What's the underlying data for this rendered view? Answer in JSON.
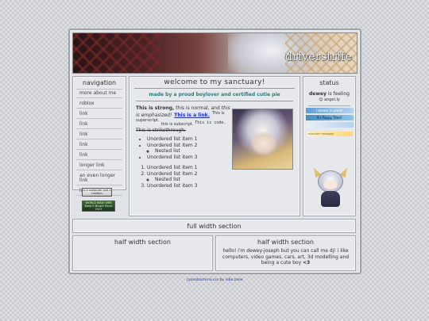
{
  "banner": {
    "logo_text": "driverstrife"
  },
  "navigation": {
    "title": "navigation",
    "items": [
      "more about me",
      "roblox",
      "link",
      "link",
      "link",
      "link",
      "link",
      "longer link",
      "an even longer link",
      "last link"
    ]
  },
  "badges": {
    "badge1": "is a computer and a modem",
    "badge2": "WORLD WIDE WEB Keep it Brown Since 2023"
  },
  "main": {
    "title": "welcome to my sanctuary!",
    "subtitle": "made by a proud boylover and certified cutie pie",
    "para": {
      "strong": "This is strong,",
      "normal": " this is normal, and",
      "emph": " this is emphasized!",
      "link": "This is a link.",
      "sup": "This is superscript.",
      "sub": "this is subscript.",
      "code": "This is code.",
      "strike": "This is strikethrough."
    },
    "ul": [
      "Unordered list item 1",
      "Unordered list item 2",
      "Nested list",
      "Unordered list item 3"
    ],
    "ol": [
      "Unordered list item 1",
      "Unordered list item 2",
      "Nested list",
      "Unordered list item 3"
    ]
  },
  "status": {
    "title": "status",
    "name": "dewey",
    "feeling_text": "is feeling",
    "mood": "angel.ly",
    "pill1": "I dream in pixels",
    "pill2": "It's Poppy Time!",
    "pill3": "",
    "pill4": "mischief managed"
  },
  "full": {
    "title": "full width section"
  },
  "half1": {
    "title": "half width section"
  },
  "half2": {
    "title": "half width section",
    "text_before": "hello! i'm dewey-joseph but you can call me dj! i like computers, video games, cars, art, 3d modelling and being a cute boy ",
    "text_strong": "<3"
  },
  "footer": {
    "link": "cyanobacteria.css",
    "by": " by ",
    "author": "nibo.zone"
  },
  "colors": {
    "accent": "#2c7b80",
    "link": "#2233aa",
    "panel_bg": "#e6e8eb"
  }
}
